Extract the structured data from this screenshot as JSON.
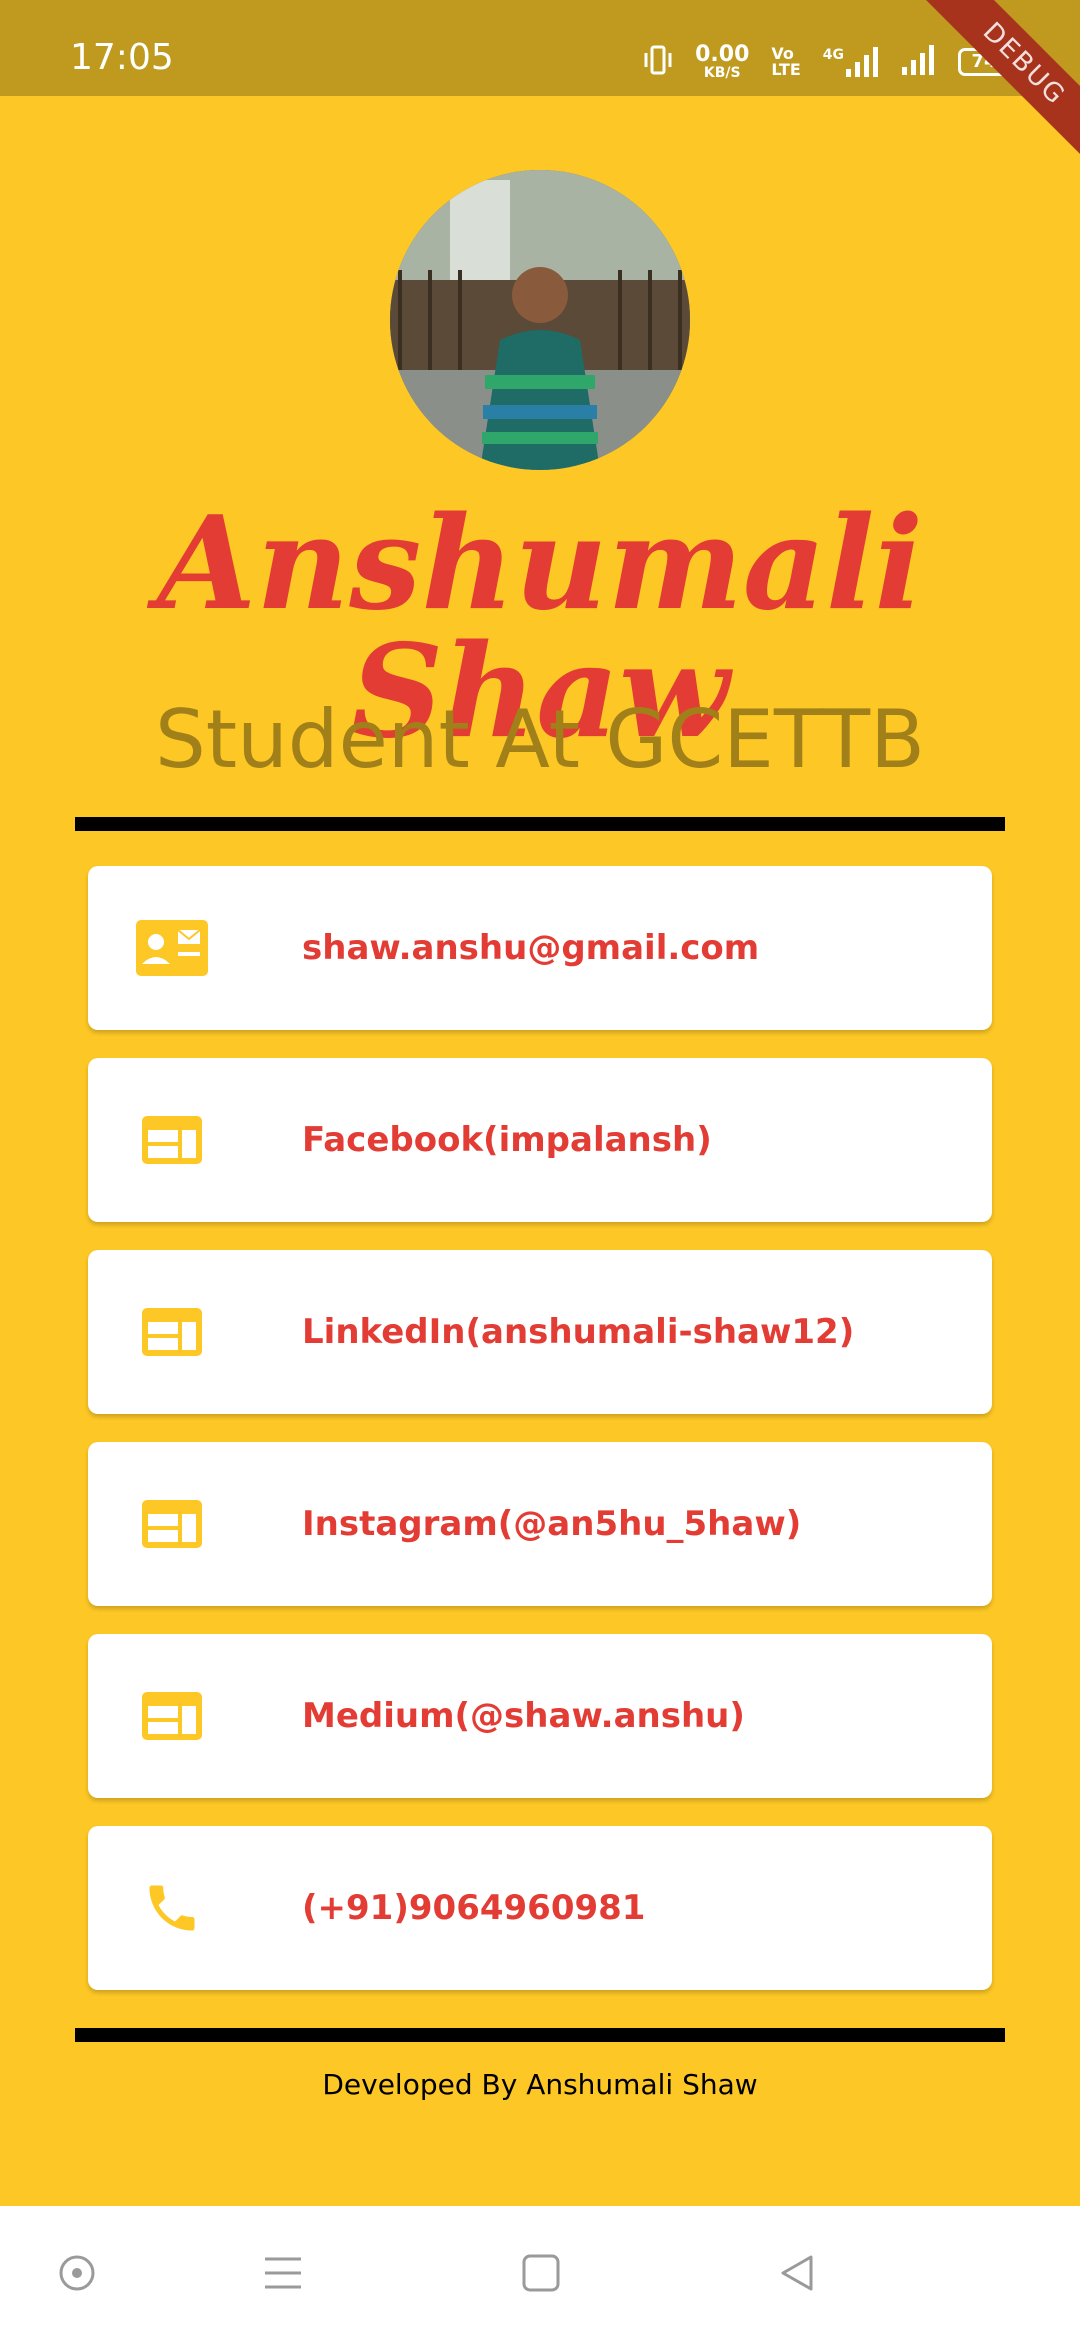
{
  "status_bar": {
    "time": "17:05",
    "net_speed_value": "0.00",
    "net_speed_unit": "KB/S",
    "volte_top": "Vo",
    "volte_bottom": "LTE",
    "network": "4G",
    "battery": "74"
  },
  "debug_banner": "DEBUG",
  "profile": {
    "name": "Anshumali Shaw",
    "subtitle": "Student At GCETTB"
  },
  "contacts": [
    {
      "icon": "contact-mail-icon",
      "text": "shaw.anshu@gmail.com"
    },
    {
      "icon": "web-icon",
      "text": "Facebook(impalansh)"
    },
    {
      "icon": "web-icon",
      "text": "LinkedIn(anshumali-shaw12)"
    },
    {
      "icon": "web-icon",
      "text": "Instagram(@an5hu_5haw)"
    },
    {
      "icon": "web-icon",
      "text": "Medium(@shaw.anshu)"
    },
    {
      "icon": "phone-icon",
      "text": "(+91)9064960981"
    }
  ],
  "footer": "Developed By Anshumali Shaw",
  "colors": {
    "background": "#FDC725",
    "status_bar": "#BF9A1F",
    "accent_red": "#E23C34",
    "subtitle": "#A1801A",
    "card": "#FFFFFF"
  }
}
